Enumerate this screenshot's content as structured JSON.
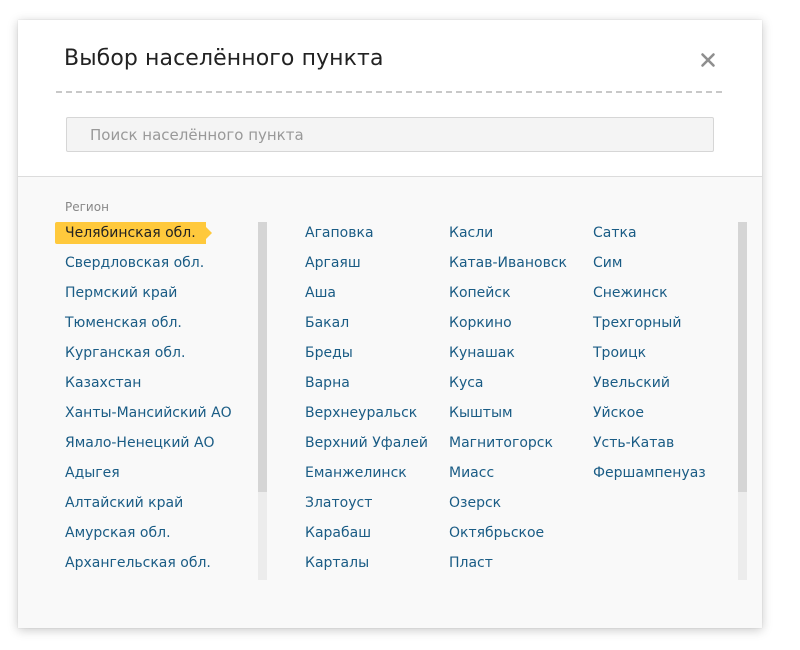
{
  "dialog": {
    "title": "Выбор населённого пункта",
    "close_label": "×",
    "search_placeholder": "Поиск населённого пункта"
  },
  "regions": {
    "label": "Регион",
    "selected": "Челябинская обл.",
    "items": [
      "Челябинская обл.",
      "Свердловская обл.",
      "Пермский край",
      "Тюменская обл.",
      "Курганская обл.",
      "Казахстан",
      "Ханты-Мансийский АО",
      "Ямало-Ненецкий АО",
      "Адыгея",
      "Алтайский край",
      "Амурская обл.",
      "Архангельская обл."
    ]
  },
  "cities": {
    "columns": [
      [
        "Агаповка",
        "Аргаяш",
        "Аша",
        "Бакал",
        "Бреды",
        "Варна",
        "Верхнеуральск",
        "Верхний Уфалей",
        "Еманжелинск",
        "Златоуст",
        "Карабаш",
        "Карталы"
      ],
      [
        "Касли",
        "Катав-Ивановск",
        "Копейск",
        "Коркино",
        "Кунашак",
        "Куса",
        "Кыштым",
        "Магнитогорск",
        "Миасс",
        "Озерск",
        "Октябрьское",
        "Пласт"
      ],
      [
        "Сатка",
        "Сим",
        "Снежинск",
        "Трехгорный",
        "Троицк",
        "Увельский",
        "Уйское",
        "Усть-Катав",
        "Фершампенуаз"
      ]
    ]
  },
  "colors": {
    "link": "#1a5c85",
    "highlight": "#ffc93c",
    "body_bg": "#f9f9f9"
  }
}
